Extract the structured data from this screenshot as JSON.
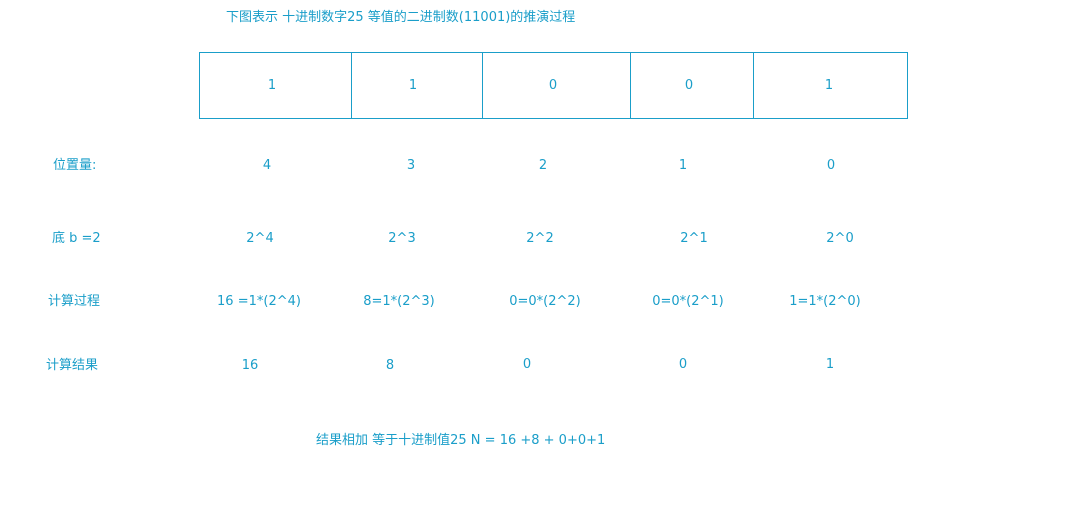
{
  "title": "下图表示 十进制数字25 等值的二进制数(11001)的推演过程",
  "bits": [
    "1",
    "1",
    "0",
    "0",
    "1"
  ],
  "rows": {
    "position": {
      "label": "位置量:",
      "values": [
        "4",
        "3",
        "2",
        "1",
        "0"
      ]
    },
    "base": {
      "label": "底 b =2",
      "values": [
        "2^4",
        "2^3",
        "2^2",
        "2^1",
        "2^0"
      ]
    },
    "process": {
      "label": "计算过程",
      "values": [
        "16 =1*(2^4)",
        "8=1*(2^3)",
        "0=0*(2^2)",
        "0=0*(2^1)",
        "1=1*(2^0)"
      ]
    },
    "result": {
      "label": "计算结果",
      "values": [
        "16",
        "8",
        "0",
        "0",
        "1"
      ]
    }
  },
  "summary": "结果相加 等于十进制值25  N = 16 +8 + 0+0+1",
  "colors": {
    "text": "#1a9ec9",
    "border": "#1a9ec9"
  }
}
